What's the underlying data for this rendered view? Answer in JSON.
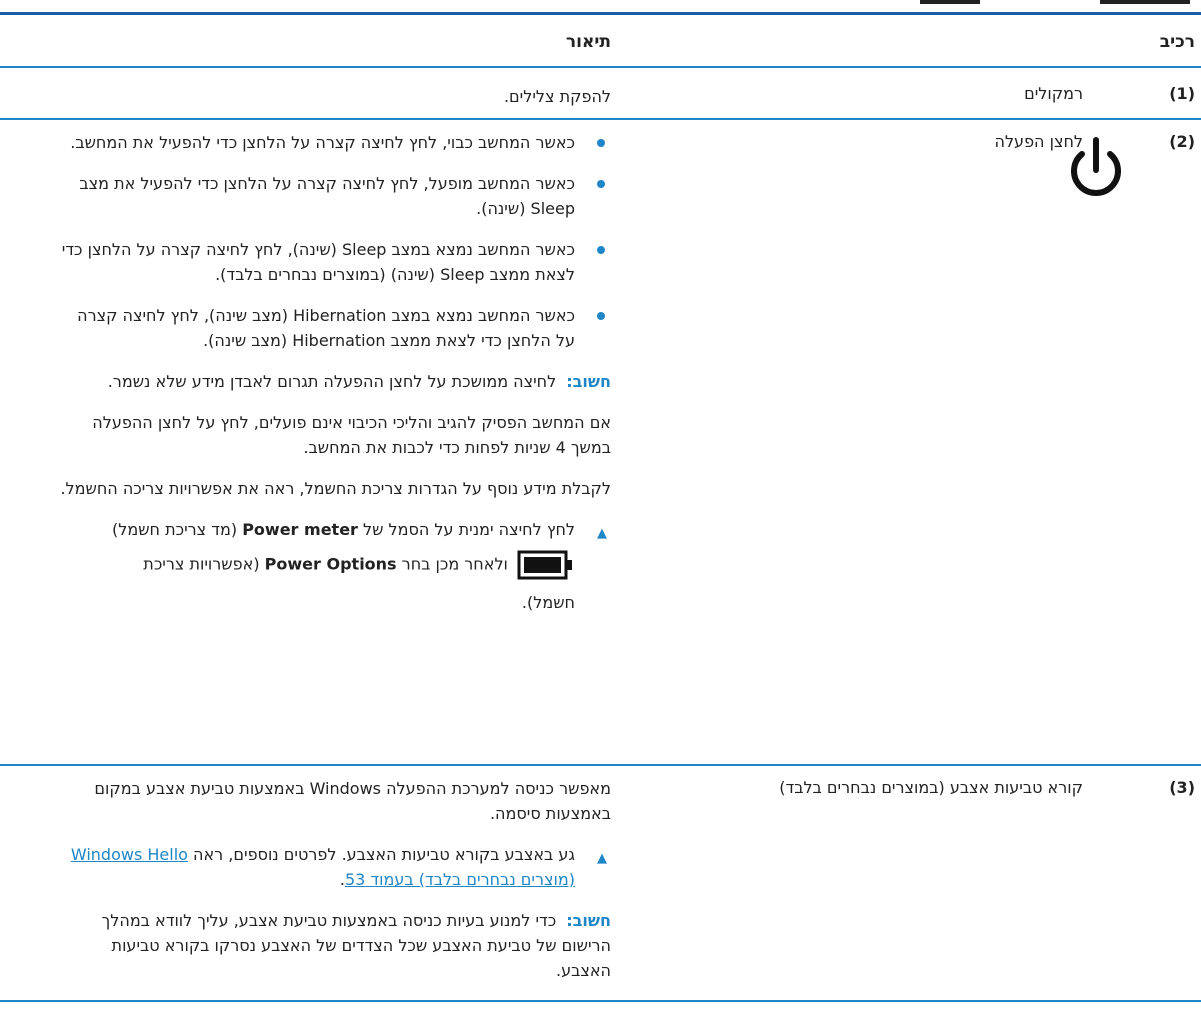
{
  "header": {
    "component": "רכיב",
    "description": "תיאור"
  },
  "rows": [
    {
      "num": "(1)",
      "component": "רמקולים",
      "description": "להפקת צלילים."
    },
    {
      "num": "(2)",
      "component": "לחצן הפעלה",
      "icon": "power-icon",
      "bullets": [
        "כאשר המחשב כבוי, לחץ לחיצה קצרה על הלחצן כדי להפעיל את המחשב.",
        "כאשר המחשב מופעל, לחץ לחיצה קצרה על הלחצן כדי להפעיל את מצב Sleep (שינה).",
        "כאשר המחשב נמצא במצב Sleep (שינה), לחץ לחיצה קצרה על הלחצן כדי לצאת ממצב Sleep (שינה) (במוצרים נבחרים בלבד).",
        "כאשר המחשב נמצא במצב Hibernation (מצב שינה), לחץ לחיצה קצרה על הלחצן כדי לצאת ממצב Hibernation (מצב שינה)."
      ],
      "important_label": "חשוב:",
      "important_text": "לחיצה ממושכת על לחצן ההפעלה תגרום לאבדן מידע שלא נשמר.",
      "para1": "אם המחשב הפסיק להגיב והליכי הכיבוי אינם פועלים, לחץ על לחצן ההפעלה במשך 4 שניות לפחות כדי לכבות את המחשב.",
      "para2": "לקבלת מידע נוסף על הגדרות צריכת החשמל, ראה את אפשרויות צריכה החשמל.",
      "step_prefix": "לחץ לחיצה ימנית על הסמל של",
      "step_bold1": "Power meter",
      "step_mid": "(מד צריכת חשמל)",
      "step_then": "ולאחר מכן בחר",
      "step_bold2": "Power Options",
      "step_end1": "(אפשרויות צריכת",
      "step_end2": "חשמל).",
      "battery_icon": "battery-icon"
    },
    {
      "num": "(3)",
      "component": "קורא טביעות אצבע (במוצרים נבחרים בלבד)",
      "para": "מאפשר כניסה למערכת ההפעלה Windows באמצעות טביעת אצבע במקום באמצעות סיסמה.",
      "step": "גע באצבע בקורא טביעות האצבע. לפרטים נוספים, ראה",
      "link": "Windows Hello (מוצרים נבחרים בלבד) בעמוד 53",
      "step_end": ".",
      "important_label": "חשוב:",
      "important_text": "כדי למנוע בעיות כניסה באמצעות טביעת אצבע, עליך לוודא במהלך הרישום של טביעת האצבע שכל הצדדים של האצבע נסרקו בקורא טביעות האצבע."
    }
  ],
  "colors": {
    "accent": "#1f86c7",
    "rule": "#1a5fa6"
  }
}
